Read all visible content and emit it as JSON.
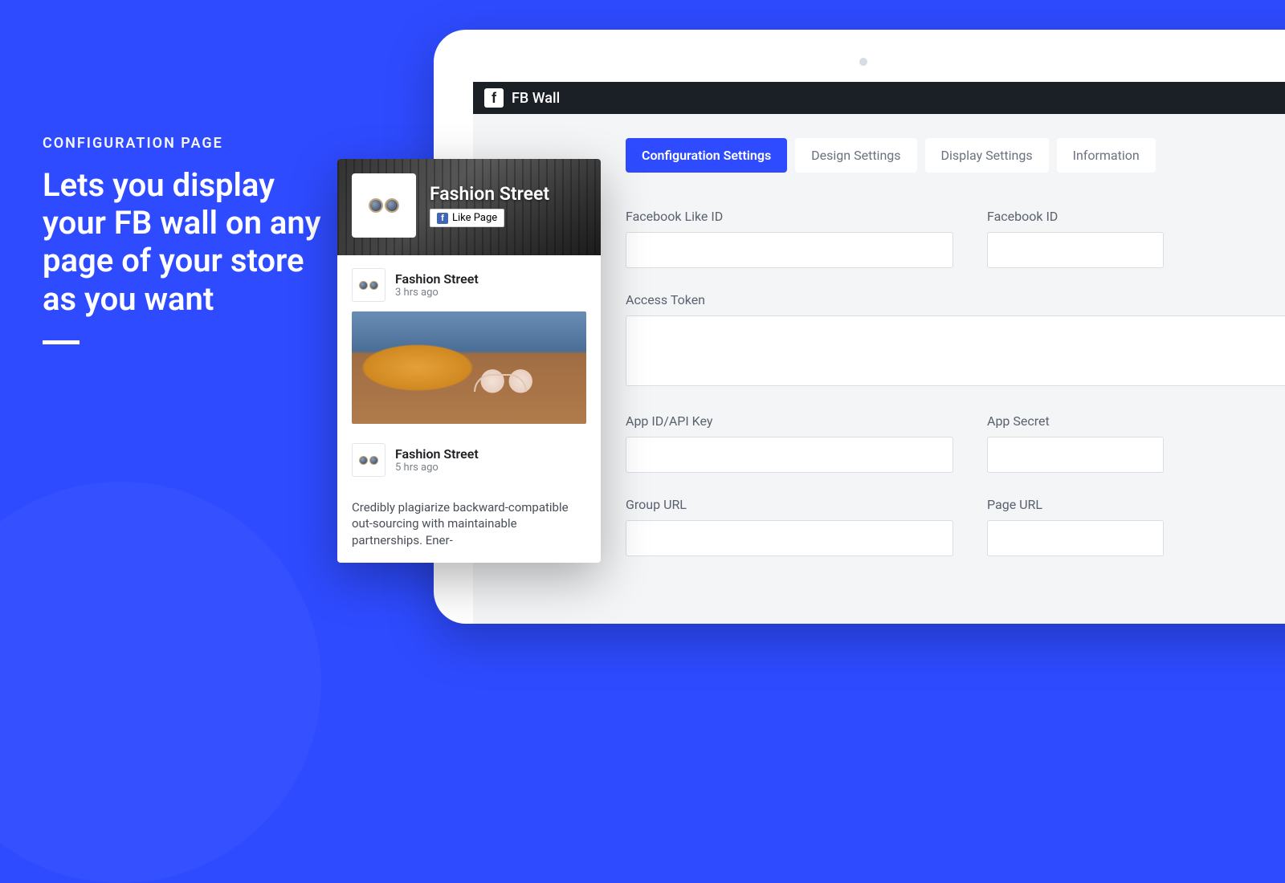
{
  "hero": {
    "eyebrow": "CONFIGURATION PAGE",
    "title": "Lets you display your FB wall on any page of your store as you want"
  },
  "app": {
    "title": "FB Wall"
  },
  "tabs": [
    {
      "label": "Configuration Settings",
      "active": true
    },
    {
      "label": "Design Settings",
      "active": false
    },
    {
      "label": "Display Settings",
      "active": false
    },
    {
      "label": "Information",
      "active": false
    }
  ],
  "form": {
    "fb_like_id": {
      "label": "Facebook Like ID",
      "value": ""
    },
    "fb_id": {
      "label": "Facebook ID",
      "value": ""
    },
    "access_token": {
      "label": "Access Token",
      "value": ""
    },
    "app_id": {
      "label": "App ID/API Key",
      "value": ""
    },
    "app_secret": {
      "label": "App Secret",
      "value": ""
    },
    "group_url": {
      "label": "Group URL",
      "value": ""
    },
    "page_url": {
      "label": "Page URL",
      "value": ""
    }
  },
  "fb_widget": {
    "page_name": "Fashion Street",
    "like_label": "Like Page",
    "posts": [
      {
        "name": "Fashion Street",
        "time": "3 hrs ago"
      },
      {
        "name": "Fashion Street",
        "time": "5 hrs ago",
        "text": "Credibly plagiarize backward-compatible out-sourcing with maintainable partnerships. Ener-"
      }
    ]
  }
}
